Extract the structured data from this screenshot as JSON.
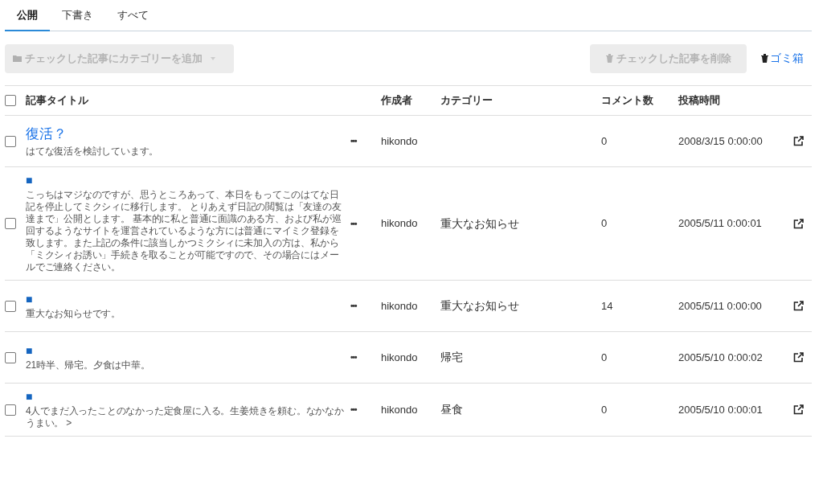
{
  "tabs": [
    {
      "label": "公開",
      "selected": true
    },
    {
      "label": "下書き",
      "selected": false
    },
    {
      "label": "すべて",
      "selected": false
    }
  ],
  "toolbar": {
    "add_category": {
      "label": "チェックした記事にカテゴリーを追加",
      "disabled": true
    },
    "delete": {
      "label": "チェックした記事を削除",
      "disabled": true
    },
    "trash": {
      "label": "ゴミ箱"
    }
  },
  "table": {
    "columns": [
      "記事タイトル",
      "作成者",
      "カテゴリー",
      "コメント数",
      "投稿時間"
    ],
    "select_all": {
      "checked": false
    },
    "rows": [
      {
        "checked": false,
        "title": "復活？",
        "kind": "titled",
        "excerpt": "はてな復活を検討しています。",
        "menu": "•••",
        "author": "hikondo",
        "category": "",
        "comments": "0",
        "posted": "2008/3/15 0:00:00"
      },
      {
        "checked": false,
        "title": "■",
        "kind": "marker",
        "excerpt": "こっちはマジなのですが、思うところあって、本日をもってこのはてな日記を停止してミクシィに移行します。 とりあえず日記の閲覧は「友達の友達まで」公開とします。 基本的に私と普通に面識のある方、および私が巡回するようなサイトを運営されているような方には普通にマイミク登録を致します。また上記の条件に該当しかつミクシィに未加入の方は、私から「ミクシィお誘い」手続きを取ることが可能ですので、その場合にはメールでご連絡ください。",
        "menu": "•••",
        "author": "hikondo",
        "category": "重大なお知らせ",
        "comments": "0",
        "posted": "2005/5/11 0:00:01"
      },
      {
        "checked": false,
        "title": "■",
        "kind": "marker",
        "excerpt": "重大なお知らせです。",
        "menu": "•••",
        "author": "hikondo",
        "category": "重大なお知らせ",
        "comments": "14",
        "posted": "2005/5/11 0:00:00"
      },
      {
        "checked": false,
        "title": "■",
        "kind": "marker",
        "excerpt": "21時半、帰宅。夕食は中華。",
        "menu": "•••",
        "author": "hikondo",
        "category": "帰宅",
        "comments": "0",
        "posted": "2005/5/10 0:00:02"
      },
      {
        "checked": false,
        "title": "■",
        "kind": "marker",
        "excerpt": "4人でまだ入ったことのなかった定食屋に入る。生姜焼きを頼む。なかなかうまい。 >",
        "menu": "•••",
        "author": "hikondo",
        "category": "昼食",
        "comments": "0",
        "posted": "2005/5/10 0:00:01"
      }
    ]
  }
}
